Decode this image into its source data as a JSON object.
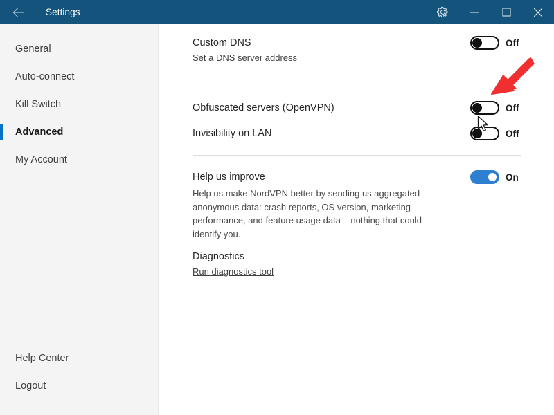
{
  "titlebar": {
    "title": "Settings",
    "back_icon": "back-arrow-icon",
    "gear_icon": "gear-icon",
    "minimize_icon": "minimize-icon",
    "maximize_icon": "maximize-icon",
    "close_icon": "close-icon",
    "background_color": "#14547c"
  },
  "sidebar": {
    "items": [
      {
        "label": "General",
        "selected": false
      },
      {
        "label": "Auto-connect",
        "selected": false
      },
      {
        "label": "Kill Switch",
        "selected": false
      },
      {
        "label": "Advanced",
        "selected": true
      },
      {
        "label": "My Account",
        "selected": false
      }
    ],
    "footer": [
      {
        "label": "Help Center"
      },
      {
        "label": "Logout"
      }
    ],
    "selected_accent_color": "#0a72c4",
    "background_color": "#f4f4f4"
  },
  "settings": {
    "custom_dns": {
      "title": "Custom DNS",
      "link": "Set a DNS server address",
      "state": "Off",
      "on": false
    },
    "obfuscated_servers": {
      "title": "Obfuscated servers (OpenVPN)",
      "state": "Off",
      "on": false
    },
    "invisibility_on_lan": {
      "title": "Invisibility on LAN",
      "state": "Off",
      "on": false
    },
    "help_us_improve": {
      "title": "Help us improve",
      "description": "Help us make NordVPN better by sending us aggregated anonymous data: crash reports, OS version, marketing performance, and feature usage data – nothing that could identify you.",
      "state": "On",
      "on": true
    },
    "diagnostics": {
      "title": "Diagnostics",
      "link": "Run diagnostics tool"
    }
  },
  "annotations": {
    "arrow_color": "#f03030",
    "arrow_target": "obfuscated-servers-toggle",
    "cursor_icon": "mouse-pointer-icon"
  }
}
